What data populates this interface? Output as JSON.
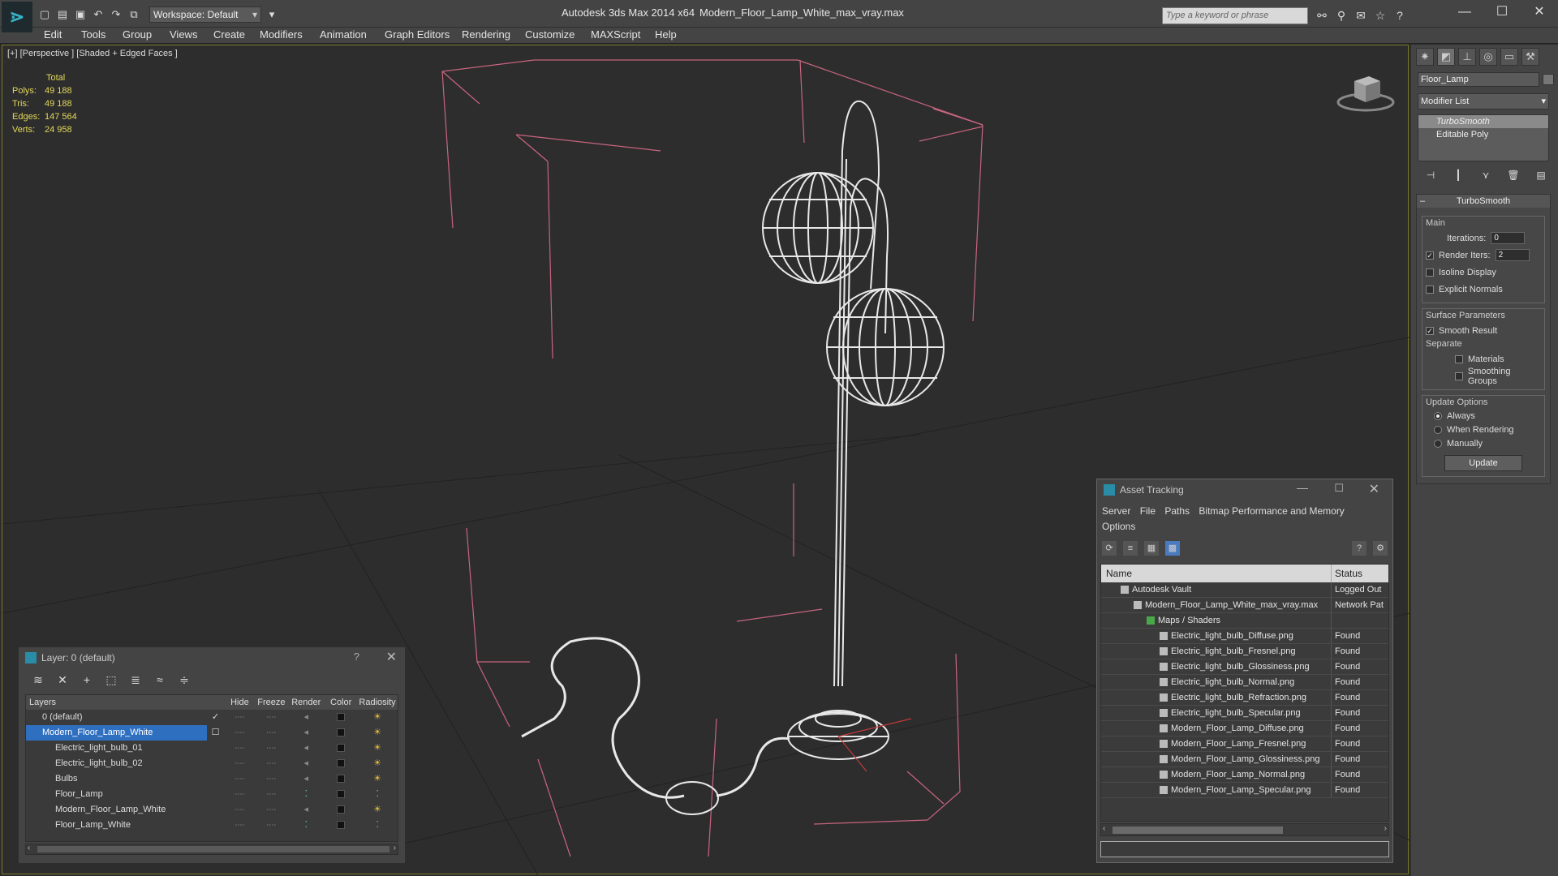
{
  "titlebar": {
    "app_title": "Autodesk 3ds Max  2014 x64",
    "file_title": "Modern_Floor_Lamp_White_max_vray.max",
    "workspace": "Workspace: Default",
    "search_placeholder": "Type a keyword or phrase"
  },
  "menu": [
    "Edit",
    "Tools",
    "Group",
    "Views",
    "Create",
    "Modifiers",
    "Animation",
    "Graph Editors",
    "Rendering",
    "Customize",
    "MAXScript",
    "Help"
  ],
  "viewport": {
    "label": "[+] [Perspective ] [Shaded + Edged Faces ]",
    "stats_header": "Total",
    "stats": [
      {
        "label": "Polys:",
        "value": "49 188"
      },
      {
        "label": "Tris:",
        "value": "49 188"
      },
      {
        "label": "Edges:",
        "value": "147 564"
      },
      {
        "label": "Verts:",
        "value": "24 958"
      }
    ]
  },
  "command_panel": {
    "object_name": "Floor_Lamp",
    "modifier_list": "Modifier List",
    "stack": [
      "TurboSmooth",
      "Editable Poly"
    ],
    "rollout_title": "TurboSmooth",
    "main_label": "Main",
    "iterations_label": "Iterations:",
    "iterations_value": "0",
    "render_iters_label": "Render Iters:",
    "render_iters_value": "2",
    "isoline_display": "Isoline Display",
    "explicit_normals": "Explicit Normals",
    "surface_params": "Surface Parameters",
    "smooth_result": "Smooth Result",
    "separate": "Separate",
    "materials": "Materials",
    "smoothing_groups": "Smoothing Groups",
    "update_options": "Update Options",
    "always": "Always",
    "when_rendering": "When Rendering",
    "manually": "Manually",
    "update_button": "Update"
  },
  "layer_window": {
    "title": "Layer: 0 (default)",
    "help": "?",
    "columns": [
      "Layers",
      "Hide",
      "Freeze",
      "Render",
      "Color",
      "Radiosity"
    ],
    "rows": [
      {
        "name": "0 (default)",
        "check": "✓"
      },
      {
        "name": "Modern_Floor_Lamp_White",
        "check": "☐"
      },
      {
        "name": "Electric_light_bulb_01",
        "check": ""
      },
      {
        "name": "Electric_light_bulb_02",
        "check": ""
      },
      {
        "name": "Bulbs",
        "check": ""
      },
      {
        "name": "Floor_Lamp",
        "check": ""
      },
      {
        "name": "Modern_Floor_Lamp_White",
        "check": ""
      },
      {
        "name": "Floor_Lamp_White",
        "check": ""
      }
    ]
  },
  "asset_window": {
    "title": "Asset Tracking",
    "menu": [
      "Server",
      "File",
      "Paths",
      "Bitmap Performance and Memory",
      "Options"
    ],
    "columns": [
      "Name",
      "Status"
    ],
    "rows": [
      {
        "name": "Autodesk Vault",
        "status": "Logged Out"
      },
      {
        "name": "Modern_Floor_Lamp_White_max_vray.max",
        "status": "Network Pat"
      },
      {
        "name": "Maps / Shaders",
        "status": ""
      },
      {
        "name": "Electric_light_bulb_Diffuse.png",
        "status": "Found"
      },
      {
        "name": "Electric_light_bulb_Fresnel.png",
        "status": "Found"
      },
      {
        "name": "Electric_light_bulb_Glossiness.png",
        "status": "Found"
      },
      {
        "name": "Electric_light_bulb_Normal.png",
        "status": "Found"
      },
      {
        "name": "Electric_light_bulb_Refraction.png",
        "status": "Found"
      },
      {
        "name": "Electric_light_bulb_Specular.png",
        "status": "Found"
      },
      {
        "name": "Modern_Floor_Lamp_Diffuse.png",
        "status": "Found"
      },
      {
        "name": "Modern_Floor_Lamp_Fresnel.png",
        "status": "Found"
      },
      {
        "name": "Modern_Floor_Lamp_Glossiness.png",
        "status": "Found"
      },
      {
        "name": "Modern_Floor_Lamp_Normal.png",
        "status": "Found"
      },
      {
        "name": "Modern_Floor_Lamp_Specular.png",
        "status": "Found"
      }
    ]
  },
  "colors": {
    "accent": "#2f6fc0",
    "stats": "#e4d85a",
    "bbox": "#d86a8a"
  }
}
